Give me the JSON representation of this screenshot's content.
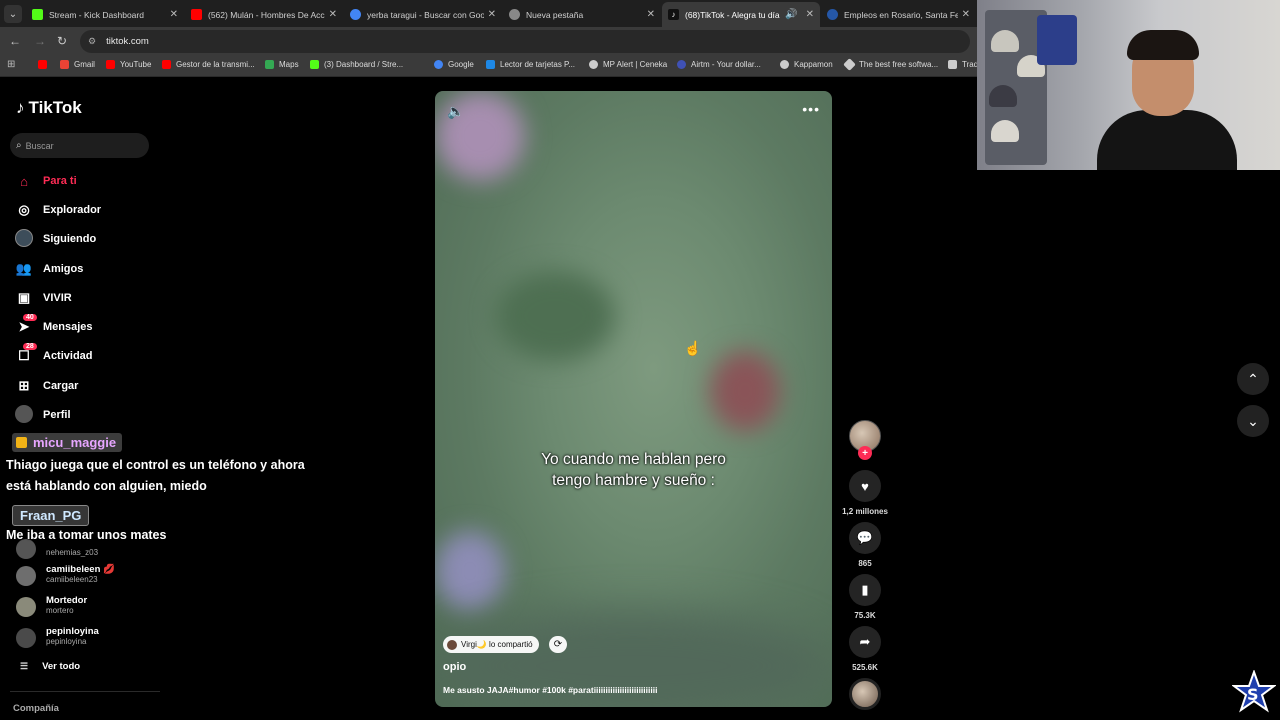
{
  "browser": {
    "tabs": [
      {
        "title": "Stream - Kick Dashboard",
        "favicon_color": "#53fc18",
        "active": false
      },
      {
        "title": "(562) Mulán - Hombres De Acción",
        "favicon_color": "#ff0000",
        "active": false
      },
      {
        "title": "yerba taragui - Buscar con Google",
        "favicon_color": "#4285f4",
        "active": false
      },
      {
        "title": "Nueva pestaña",
        "favicon_color": "#888888",
        "active": false
      },
      {
        "title": "(68)TikTok - Alegra tu día",
        "favicon_color": "#111111",
        "active": true
      },
      {
        "title": "Empleos en Rosario, Santa Fe",
        "favicon_color": "#2557a7",
        "active": false
      }
    ],
    "url": "tiktok.com",
    "bookmarks": [
      {
        "label": "",
        "color": "#ff0000"
      },
      {
        "label": "Gmail",
        "color": "#ea4335"
      },
      {
        "label": "YouTube",
        "color": "#ff0000"
      },
      {
        "label": "Gestor de la transmi...",
        "color": "#ff0000"
      },
      {
        "label": "Maps",
        "color": "#34a853"
      },
      {
        "label": "(3) Dashboard / Stre...",
        "color": "#53fc18"
      },
      {
        "label": "Google",
        "color": "#4285f4"
      },
      {
        "label": "Lector de tarjetas P...",
        "color": "#1e88e5"
      },
      {
        "label": "MP Alert | Ceneka",
        "color": "#cccccc"
      },
      {
        "label": "Airtm - Your dollar...",
        "color": "#3f51b5"
      },
      {
        "label": "Kappamon",
        "color": "#cccccc"
      },
      {
        "label": "The best free softwa...",
        "color": "#cccccc"
      },
      {
        "label": "Tradi",
        "color": "#cccccc"
      }
    ]
  },
  "tiktok": {
    "logo": "TikTok",
    "search_placeholder": "Buscar",
    "nav": [
      {
        "label": "Para ti",
        "icon": "home-icon",
        "active": true,
        "badge": ""
      },
      {
        "label": "Explorador",
        "icon": "compass-icon",
        "active": false,
        "badge": ""
      },
      {
        "label": "Siguiendo",
        "icon": "following-avatar-icon",
        "active": false,
        "badge": ""
      },
      {
        "label": "Amigos",
        "icon": "friends-icon",
        "active": false,
        "badge": ""
      },
      {
        "label": "VIVIR",
        "icon": "live-icon",
        "active": false,
        "badge": ""
      },
      {
        "label": "Mensajes",
        "icon": "send-icon",
        "active": false,
        "badge": "40"
      },
      {
        "label": "Actividad",
        "icon": "inbox-icon",
        "active": false,
        "badge": "28"
      },
      {
        "label": "Cargar",
        "icon": "upload-icon",
        "active": false,
        "badge": ""
      },
      {
        "label": "Perfil",
        "icon": "profile-icon",
        "active": false,
        "badge": ""
      }
    ],
    "following_accounts": [
      {
        "name": "",
        "user": "nehemias_z03"
      },
      {
        "name": "camiibeleen 💋",
        "user": "camiibeleen23"
      },
      {
        "name": "Mortedor",
        "user": "mortero"
      },
      {
        "name": "pepinloyina",
        "user": "pepinloyina"
      }
    ],
    "see_all": "Ver todo",
    "company": "Compañía"
  },
  "chat": {
    "user1": "micu_maggie",
    "msg1": "Thiago juega que el control es un teléfono y ahora está hablando con alguien, miedo",
    "user2": "Fraan_PG",
    "msg2": "Me iba a tomar unos mates"
  },
  "video": {
    "caption_line1": "Yo cuando me hablan pero",
    "caption_line2": "tengo hambre y sueño :",
    "shared_by": "Virgi🌙 lo compartió",
    "author": "opio",
    "description": "Me asusto JAJA#humor #100k #paratiiiiiiiiiiiiiiiiiiiiiiiiiii"
  },
  "actions": {
    "likes": "1,2 millones",
    "comments": "865",
    "saves": "75.3K",
    "shares": "525.6K"
  }
}
